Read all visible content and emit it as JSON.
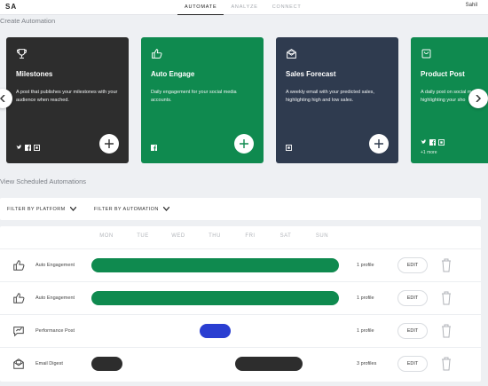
{
  "app": {
    "logo": "SA",
    "user": "Sahil"
  },
  "nav": [
    {
      "label": "AUTOMATE",
      "active": true
    },
    {
      "label": "ANALYZE",
      "active": false
    },
    {
      "label": "CONNECT",
      "active": false
    }
  ],
  "create_section": {
    "title": "Create Automation"
  },
  "cards": [
    {
      "title": "Milestones",
      "description": "A post that publishes your milestones with your audience when reached.",
      "color": "#2d2d2d",
      "icon": "trophy-icon",
      "socials": [
        "twitter-icon",
        "facebook-icon",
        "instagram-icon"
      ],
      "more": ""
    },
    {
      "title": "Auto Engage",
      "description": "Daily engagement for your social media accounts.",
      "color": "#0f8a4f",
      "icon": "thumbs-up-icon",
      "socials": [
        "facebook-icon"
      ],
      "more": ""
    },
    {
      "title": "Sales Forecast",
      "description": "A weekly email with your predicted sales, highlighting high and low sales.",
      "color": "#2f3b4f",
      "icon": "email-icon",
      "socials": [
        "instagram-icon"
      ],
      "more": ""
    },
    {
      "title": "Product Post",
      "description": "A daily post on social media highlighting your sho",
      "color": "#0f8a4f",
      "icon": "shopping-bag-icon",
      "socials": [
        "twitter-icon",
        "facebook-icon",
        "instagram-icon"
      ],
      "more": "+1 more"
    }
  ],
  "scheduled_section": {
    "title": "View Scheduled Automations"
  },
  "filters": {
    "platform": "FILTER BY PLATFORM",
    "automation": "FILTER BY AUTOMATION"
  },
  "days": [
    "MON",
    "TUE",
    "WED",
    "THU",
    "FRI",
    "SAT",
    "SUN"
  ],
  "rows": [
    {
      "name": "Auto Engagement",
      "icon": "thumbs-up-icon",
      "profiles": "1 profile",
      "edit": "EDIT",
      "bars": [
        {
          "start": 0,
          "end": 7,
          "color": "#0f8a4f"
        }
      ]
    },
    {
      "name": "Auto Engagement",
      "icon": "thumbs-up-icon",
      "profiles": "1 profile",
      "edit": "EDIT",
      "bars": [
        {
          "start": 0,
          "end": 7,
          "color": "#0f8a4f"
        }
      ]
    },
    {
      "name": "Performance Post",
      "icon": "chat-icon",
      "profiles": "1 profile",
      "edit": "EDIT",
      "bars": [
        {
          "start": 3,
          "end": 4,
          "color": "#2a3ed1"
        }
      ]
    },
    {
      "name": "Email Digest",
      "icon": "email-icon",
      "profiles": "3 profiles",
      "edit": "EDIT",
      "bars": [
        {
          "start": 0,
          "end": 1,
          "color": "#2d2d2d"
        },
        {
          "start": 4,
          "end": 6,
          "color": "#2d2d2d"
        }
      ]
    }
  ]
}
